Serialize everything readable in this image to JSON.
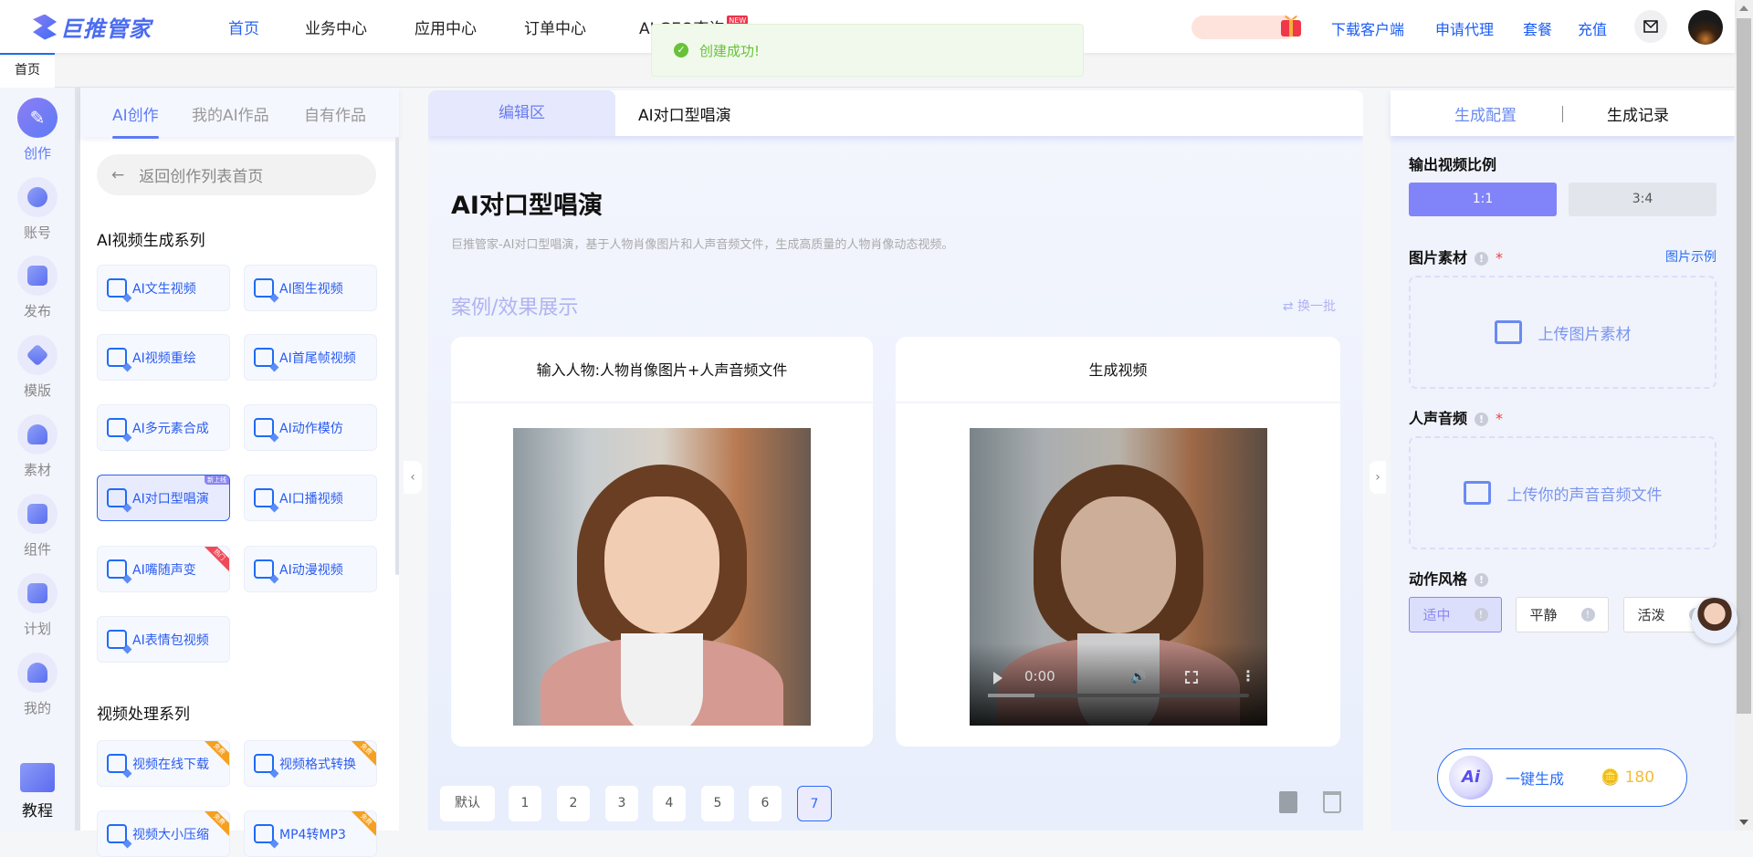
{
  "header": {
    "logo_text": "巨推管家",
    "nav": [
      {
        "label": "首页",
        "active": true
      },
      {
        "label": "业务中心"
      },
      {
        "label": "应用中心"
      },
      {
        "label": "订单中心"
      },
      {
        "label": "AI GEO查询",
        "badge": "NEW"
      }
    ],
    "links": [
      "下载客户端",
      "申请代理",
      "套餐",
      "充值"
    ]
  },
  "tabs": {
    "home": "首页"
  },
  "toast": {
    "message": "创建成功!"
  },
  "rail": [
    {
      "label": "创作",
      "icon": "pencil-icon",
      "active": true
    },
    {
      "label": "账号",
      "icon": "add-user-icon"
    },
    {
      "label": "发布",
      "icon": "publish-icon"
    },
    {
      "label": "模版",
      "icon": "layers-icon"
    },
    {
      "label": "素材",
      "icon": "cloud-upload-icon"
    },
    {
      "label": "组件",
      "icon": "puzzle-icon"
    },
    {
      "label": "计划",
      "icon": "calendar-icon"
    },
    {
      "label": "我的",
      "icon": "user-icon"
    },
    {
      "label": "教程",
      "icon": "book-icon"
    }
  ],
  "left_panel": {
    "tabs": [
      "AI创作",
      "我的AI作品",
      "自有作品"
    ],
    "back": "返回创作列表首页",
    "sections": [
      {
        "title": "AI视频生成系列",
        "items": [
          {
            "label": "AI文生视频"
          },
          {
            "label": "AI图生视频"
          },
          {
            "label": "AI视频重绘"
          },
          {
            "label": "AI首尾帧视频"
          },
          {
            "label": "AI多元素合成"
          },
          {
            "label": "AI动作模仿"
          },
          {
            "label": "AI对口型唱演",
            "tag": "新上线",
            "active": true
          },
          {
            "label": "AI口播视频"
          },
          {
            "label": "AI嘴随声变",
            "tag": "热门"
          },
          {
            "label": "AI动漫视频"
          },
          {
            "label": "AI表情包视频"
          }
        ]
      },
      {
        "title": "视频处理系列",
        "items": [
          {
            "label": "视频在线下载",
            "tag": "免费"
          },
          {
            "label": "视频格式转换",
            "tag": "免费"
          },
          {
            "label": "视频大小压缩",
            "tag": "免费"
          },
          {
            "label": "MP4转MP3",
            "tag": "免费"
          }
        ]
      }
    ]
  },
  "center": {
    "tabs": [
      "编辑区",
      "AI对口型唱演"
    ],
    "title": "AI对口型唱演",
    "description": "巨推管家-AI对口型唱演，基于人物肖像图片和人声音频文件，生成高质量的人物肖像动态视频。",
    "cases_title": "案例/效果展示",
    "refresh": "换一批",
    "cards": [
      {
        "title": "输入人物:人物肖像图片+人声音频文件"
      },
      {
        "title": "生成视频",
        "video_time": "0:00",
        "video_progress": 0.18
      }
    ],
    "pagination": {
      "default": "默认",
      "pages": [
        "1",
        "2",
        "3",
        "4",
        "5",
        "6",
        "7"
      ],
      "current": "7"
    }
  },
  "right_panel": {
    "tabs": [
      "生成配置",
      "生成记录"
    ],
    "ratio_label": "输出视频比例",
    "ratios": [
      "1:1",
      "3:4"
    ],
    "selected_ratio": "1:1",
    "image_label": "图片素材",
    "image_example": "图片示例",
    "image_upload": "上传图片素材",
    "audio_label": "人声音频",
    "audio_upload": "上传你的声音音频文件",
    "style_label": "动作风格",
    "styles": [
      "适中",
      "平静",
      "活泼"
    ],
    "selected_style": "适中",
    "generate": "一键生成",
    "cost": "180",
    "required_mark": "*"
  },
  "colors": {
    "accent": "#5c7cf5",
    "link": "#1a5cf5",
    "success": "#67c23a",
    "selected": "#8183f8"
  }
}
